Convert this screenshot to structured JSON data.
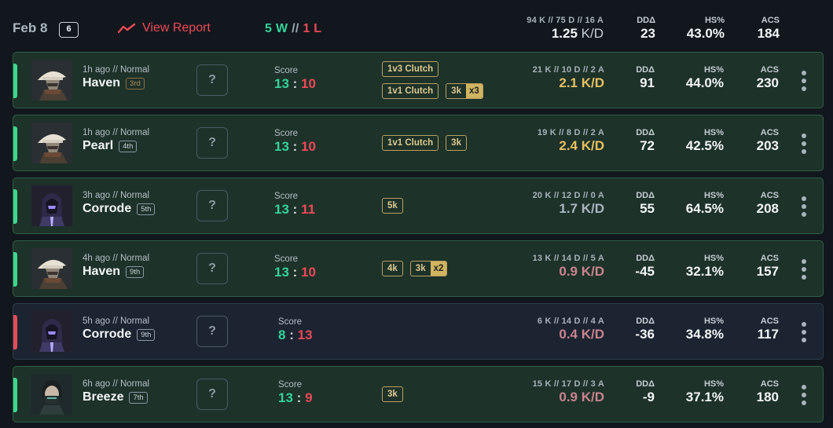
{
  "header": {
    "date": "Feb 8",
    "match_count": "6",
    "report_label": "View Report",
    "wins": "5 W",
    "record_sep": "//",
    "losses": "1 L",
    "kda": "94 K // 75 D // 16 A",
    "kd_value": "1.25",
    "kd_unit": "K/D",
    "dd_label": "DDΔ",
    "dd_value": "23",
    "hs_label": "HS%",
    "hs_value": "43.0%",
    "acs_label": "ACS",
    "acs_value": "184"
  },
  "colors": {
    "win_green": "#34d399",
    "loss_red": "#ee4a58",
    "kd_gold": "#e8c063",
    "kd_gray": "#a9b6c2",
    "kd_pink": "#c9848f",
    "badge_gold": "#d0b45f"
  },
  "labels": {
    "score": "Score",
    "unknown": "?",
    "dd": "DDΔ",
    "hs": "HS%",
    "acs": "ACS"
  },
  "matches": [
    {
      "agent_icon": "agent-cowboy-hat-icon",
      "time": "1h ago // Normal",
      "map": "Haven",
      "placement": "3rd",
      "result": "win",
      "score_us": "13",
      "score_sep": ":",
      "score_them": "10",
      "badges": [
        [
          "1v3 Clutch"
        ],
        [
          "1v1 Clutch",
          "3k|x3"
        ]
      ],
      "kda": "21 K // 10 D // 2 A",
      "kd": "2.1 K/D",
      "kd_color": "#e8c063",
      "dd": "91",
      "hs": "44.0%",
      "acs": "230"
    },
    {
      "agent_icon": "agent-cowboy-hat-icon",
      "time": "1h ago // Normal",
      "map": "Pearl",
      "placement": "4th",
      "result": "win",
      "score_us": "13",
      "score_sep": ":",
      "score_them": "10",
      "badges": [
        [
          "1v1 Clutch",
          "3k"
        ]
      ],
      "kda": "19 K // 8 D // 2 A",
      "kd": "2.4 K/D",
      "kd_color": "#e8c063",
      "dd": "72",
      "hs": "42.5%",
      "acs": "203"
    },
    {
      "agent_icon": "agent-hooded-purple-icon",
      "time": "3h ago // Normal",
      "map": "Corrode",
      "placement": "5th",
      "result": "win",
      "score_us": "13",
      "score_sep": ":",
      "score_them": "11",
      "badges": [
        [
          "5k"
        ]
      ],
      "kda": "20 K // 12 D // 0 A",
      "kd": "1.7 K/D",
      "kd_color": "#a9b6c2",
      "dd": "55",
      "hs": "64.5%",
      "acs": "208"
    },
    {
      "agent_icon": "agent-cowboy-hat-icon",
      "time": "4h ago // Normal",
      "map": "Haven",
      "placement": "9th",
      "result": "win",
      "score_us": "13",
      "score_sep": ":",
      "score_them": "10",
      "badges": [
        [
          "4k",
          "3k|x2"
        ]
      ],
      "kda": "13 K // 14 D // 5 A",
      "kd": "0.9 K/D",
      "kd_color": "#c9848f",
      "dd": "-45",
      "hs": "32.1%",
      "acs": "157"
    },
    {
      "agent_icon": "agent-hooded-purple-icon",
      "time": "5h ago // Normal",
      "map": "Corrode",
      "placement": "9th",
      "result": "loss",
      "score_us": "8",
      "score_sep": ":",
      "score_them": "13",
      "badges": [],
      "kda": "6 K // 14 D // 4 A",
      "kd": "0.4 K/D",
      "kd_color": "#c9848f",
      "dd": "-36",
      "hs": "34.8%",
      "acs": "117"
    },
    {
      "agent_icon": "agent-masked-teal-icon",
      "time": "6h ago // Normal",
      "map": "Breeze",
      "placement": "7th",
      "result": "win",
      "score_us": "13",
      "score_sep": ":",
      "score_them": "9",
      "badges": [
        [
          "3k"
        ]
      ],
      "kda": "15 K // 17 D // 3 A",
      "kd": "0.9 K/D",
      "kd_color": "#c9848f",
      "dd": "-9",
      "hs": "37.1%",
      "acs": "180"
    }
  ]
}
